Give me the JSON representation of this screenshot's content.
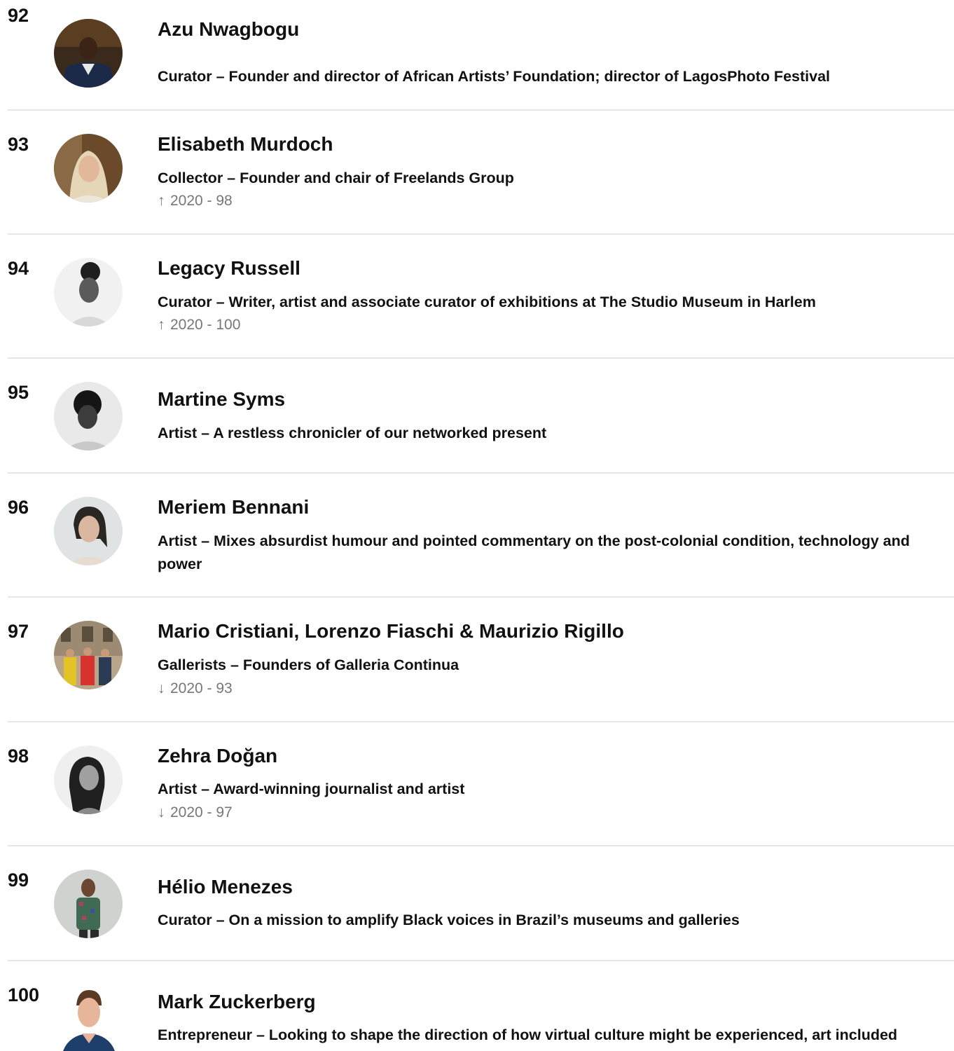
{
  "entries": [
    {
      "rank": "92",
      "name": "Azu Nwagbogu",
      "role": "Curator – Founder and director of African Artists’ Foundation; director of LagosPhoto Festival",
      "change_arrow": "",
      "change": "",
      "avatar_icon": "portrait-man-suit-photo"
    },
    {
      "rank": "93",
      "name": "Elisabeth Murdoch",
      "role": "Collector – Founder and chair of Freelands Group",
      "change_arrow": "↑",
      "change": "2020 - 98",
      "avatar_icon": "portrait-woman-blonde-photo"
    },
    {
      "rank": "94",
      "name": "Legacy Russell",
      "role": "Curator – Writer, artist and associate curator of exhibitions at The Studio Museum in Harlem",
      "change_arrow": "↑",
      "change": "2020 - 100",
      "avatar_icon": "portrait-woman-bw-photo"
    },
    {
      "rank": "95",
      "name": "Martine Syms",
      "role": "Artist – A restless chronicler of our networked present",
      "change_arrow": "",
      "change": "",
      "avatar_icon": "portrait-woman-bw-photo"
    },
    {
      "rank": "96",
      "name": "Meriem Bennani",
      "role": "Artist – Mixes absurdist humour and pointed commentary on the post-colonial condition, technology and power",
      "change_arrow": "",
      "change": "",
      "avatar_icon": "portrait-woman-photo"
    },
    {
      "rank": "97",
      "name": "Mario Cristiani, Lorenzo Fiaschi & Maurizio Rigillo",
      "role": "Gallerists – Founders of Galleria Continua",
      "change_arrow": "↓",
      "change": "2020 - 93",
      "avatar_icon": "group-portrait-photo"
    },
    {
      "rank": "98",
      "name": "Zehra Doğan",
      "role": "Artist – Award-winning journalist and artist",
      "change_arrow": "↓",
      "change": "2020 - 97",
      "avatar_icon": "portrait-woman-bw-photo"
    },
    {
      "rank": "99",
      "name": "Hélio Menezes",
      "role": "Curator – On a mission to amplify Black voices in Brazil’s museums and galleries",
      "change_arrow": "",
      "change": "",
      "avatar_icon": "portrait-man-patterned-shirt-photo"
    },
    {
      "rank": "100",
      "name": "Mark Zuckerberg",
      "role": "Entrepreneur – Looking to shape the direction of how virtual culture might be experienced, art included",
      "change_arrow": "",
      "change": "",
      "avatar_icon": "portrait-man-photo"
    }
  ],
  "colors": {
    "text": "#111111",
    "muted": "#777777",
    "divider": "#e6e6e6",
    "background": "#ffffff"
  }
}
